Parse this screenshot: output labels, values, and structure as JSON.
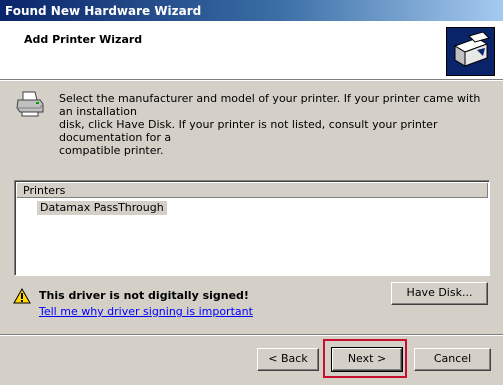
{
  "window": {
    "title": "Found New Hardware Wizard"
  },
  "header": {
    "title": "Add Printer Wizard",
    "icon": "hardware-wizard-icon"
  },
  "instructions": {
    "icon": "printer-icon",
    "text": "Select the manufacturer and model of your printer. If your printer came with an installation\ndisk, click Have Disk. If your printer is not listed, consult your printer documentation for a\ncompatible printer."
  },
  "printers_list": {
    "header": "Printers",
    "items": [
      "Datamax PassThrough"
    ],
    "selected_index": 0
  },
  "warning": {
    "icon": "warning-icon",
    "text": "This driver is not digitally signed!",
    "link": "Tell me why driver signing is important"
  },
  "buttons": {
    "have_disk": "Have Disk...",
    "back": "< Back",
    "next": "Next >",
    "cancel": "Cancel"
  },
  "colors": {
    "title_bar_start": "#0a246a",
    "title_bar_end": "#a6caf0",
    "dialog_face": "#d4d0c8",
    "link": "#0000ff",
    "highlight_box": "#c8102e"
  }
}
